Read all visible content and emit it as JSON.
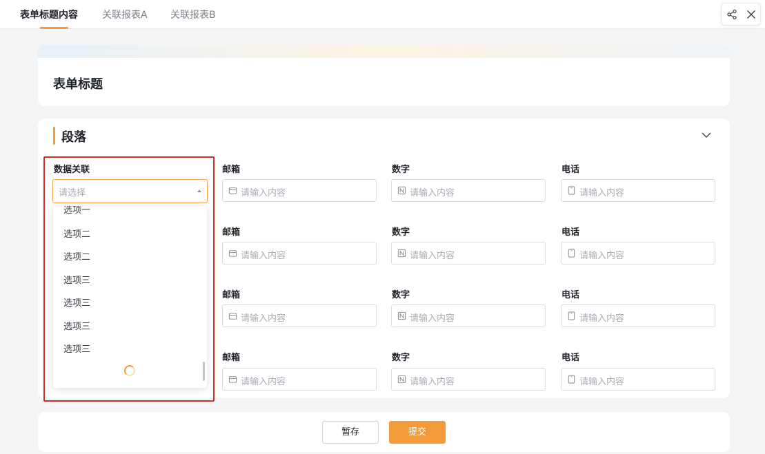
{
  "tabs": [
    {
      "label": "表单标题内容",
      "active": true
    },
    {
      "label": "关联报表A",
      "active": false
    },
    {
      "label": "关联报表B",
      "active": false
    }
  ],
  "top_actions": {
    "share_icon": "share-icon",
    "close_icon": "close-icon"
  },
  "form": {
    "title": "表单标题"
  },
  "section": {
    "title": "段落",
    "collapse_icon": "chevron-down-icon"
  },
  "data_link_field": {
    "label": "数据关联",
    "placeholder": "请选择",
    "options": [
      "选项一",
      "选项二",
      "选项二",
      "选项三",
      "选项三",
      "选项三",
      "选项三"
    ]
  },
  "field_rows": [
    {
      "email_label": "邮箱",
      "email_placeholder": "请输入内容",
      "number_label": "数字",
      "number_placeholder": "请输入内容",
      "phone_label": "电话",
      "phone_placeholder": "请输入内容"
    },
    {
      "email_label": "邮箱",
      "email_placeholder": "请输入内容",
      "number_label": "数字",
      "number_placeholder": "请输入内容",
      "phone_label": "电话",
      "phone_placeholder": "请输入内容"
    },
    {
      "email_label": "邮箱",
      "email_placeholder": "请输入内容",
      "number_label": "数字",
      "number_placeholder": "请输入内容",
      "phone_label": "电话",
      "phone_placeholder": "请输入内容"
    },
    {
      "email_label": "邮箱",
      "email_placeholder": "请输入内容",
      "number_label": "数字",
      "number_placeholder": "请输入内容",
      "phone_label": "电话",
      "phone_placeholder": "请输入内容"
    }
  ],
  "footer": {
    "save_label": "暂存",
    "submit_label": "提交"
  },
  "colors": {
    "accent": "#f39a3a",
    "highlight": "#d42b2b"
  }
}
